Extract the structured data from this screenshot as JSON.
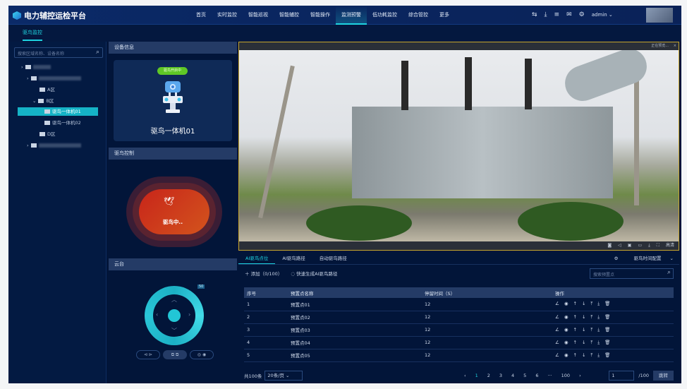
{
  "header": {
    "title": "电力辅控运检平台",
    "nav": [
      "首页",
      "实时监控",
      "智能巡视",
      "智能辅控",
      "智能操作",
      "监测预警",
      "低功耗监控",
      "综合管控",
      "更多"
    ],
    "active_nav": "监测预警",
    "user": "admin",
    "icons": [
      "switch-icon",
      "download-icon",
      "list-icon",
      "mail-icon",
      "settings-icon"
    ]
  },
  "subnav": {
    "tab": "驱鸟监控"
  },
  "tree": {
    "search_placeholder": "搜索区域名称、设备名称",
    "nodes": [
      {
        "label": "A区"
      },
      {
        "label": "B区"
      },
      {
        "label": "驱鸟一体机01",
        "selected": true
      },
      {
        "label": "驱鸟一体机02"
      },
      {
        "label": "D区"
      }
    ]
  },
  "device": {
    "title": "设备信息",
    "status": "驱鸟开启中",
    "name": "驱鸟一体机01",
    "status_color": "#5fc726"
  },
  "control": {
    "title": "驱鸟控制",
    "label": "驱鸟中.."
  },
  "ptz": {
    "title": "云台",
    "speed": "50"
  },
  "video": {
    "status": "正在预览...",
    "quality": "高清"
  },
  "tabs": {
    "items": [
      "AI驱鸟点位",
      "AI驱鸟路径",
      "自动驱鸟路径"
    ],
    "active": 0,
    "config": "驱鸟时间配置"
  },
  "toolbar": {
    "add": "添加（0/100）",
    "quick": "快速生成AI驱鸟路径",
    "search_placeholder": "搜索预置点"
  },
  "table": {
    "headers": [
      "序号",
      "预置点名称",
      "停留时间（S）",
      "操作"
    ],
    "rows": [
      [
        "1",
        "预置点01",
        "12"
      ],
      [
        "2",
        "预置点02",
        "12"
      ],
      [
        "3",
        "预置点03",
        "12"
      ],
      [
        "4",
        "预置点04",
        "12"
      ],
      [
        "5",
        "预置点05",
        "12"
      ]
    ]
  },
  "pager": {
    "total": "共100条",
    "size": "20条/页",
    "pages": [
      "1",
      "2",
      "3",
      "4",
      "5",
      "6",
      "···",
      "100"
    ],
    "current": "1",
    "input": "1",
    "of": "/100",
    "jump": "跳转"
  }
}
